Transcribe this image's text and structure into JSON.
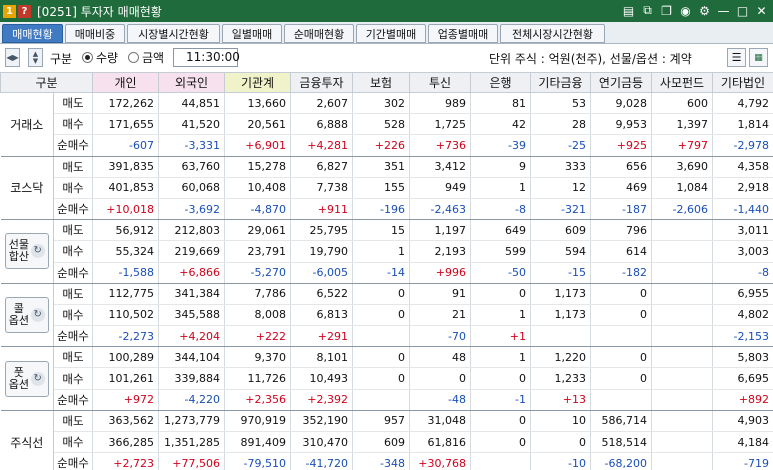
{
  "window": {
    "badge1": "1",
    "badge2": "?",
    "title": "[0251] 투자자 매매현황"
  },
  "tabs": [
    {
      "label": "매매현황",
      "active": true
    },
    {
      "label": "매매비중",
      "active": false
    },
    {
      "label": "시장별시간현황",
      "active": false
    },
    {
      "label": "일별매매",
      "active": false
    },
    {
      "label": "순매매현황",
      "active": false
    },
    {
      "label": "기간별매매",
      "active": false
    },
    {
      "label": "업종별매매",
      "active": false
    },
    {
      "label": "전체시장시간현황",
      "active": false
    }
  ],
  "toolbar": {
    "label": "구분",
    "radio_qty": "수량",
    "radio_amt": "금액",
    "selected": "수량",
    "time": "11:30:00",
    "unit_text": "단위 주식 : 억원(천주), 선물/옵션 : 계약"
  },
  "header": [
    "구분",
    "개인",
    "외국인",
    "기관계",
    "금융투자",
    "보험",
    "투신",
    "은행",
    "기타금융",
    "연기금등",
    "사모펀드",
    "기타법인"
  ],
  "groups": [
    {
      "name": "거래소",
      "button": false,
      "rows": [
        {
          "label": "매도",
          "values": [
            "172,262",
            "44,851",
            "13,660",
            "2,607",
            "302",
            "989",
            "81",
            "53",
            "9,028",
            "600",
            "4,792"
          ]
        },
        {
          "label": "매수",
          "values": [
            "171,655",
            "41,520",
            "20,561",
            "6,888",
            "528",
            "1,725",
            "42",
            "28",
            "9,953",
            "1,397",
            "1,814"
          ]
        },
        {
          "label": "순매수",
          "values": [
            "-607",
            "-3,331",
            "+6,901",
            "+4,281",
            "+226",
            "+736",
            "-39",
            "-25",
            "+925",
            "+797",
            "-2,978"
          ]
        }
      ]
    },
    {
      "name": "코스닥",
      "button": false,
      "rows": [
        {
          "label": "매도",
          "values": [
            "391,835",
            "63,760",
            "15,278",
            "6,827",
            "351",
            "3,412",
            "9",
            "333",
            "656",
            "3,690",
            "4,358"
          ]
        },
        {
          "label": "매수",
          "values": [
            "401,853",
            "60,068",
            "10,408",
            "7,738",
            "155",
            "949",
            "1",
            "12",
            "469",
            "1,084",
            "2,918"
          ]
        },
        {
          "label": "순매수",
          "values": [
            "+10,018",
            "-3,692",
            "-4,870",
            "+911",
            "-196",
            "-2,463",
            "-8",
            "-321",
            "-187",
            "-2,606",
            "-1,440"
          ]
        }
      ]
    },
    {
      "name": "선물\n합산",
      "button": true,
      "rows": [
        {
          "label": "매도",
          "values": [
            "56,912",
            "212,803",
            "29,061",
            "25,795",
            "15",
            "1,197",
            "649",
            "609",
            "796",
            "",
            "3,011"
          ]
        },
        {
          "label": "매수",
          "values": [
            "55,324",
            "219,669",
            "23,791",
            "19,790",
            "1",
            "2,193",
            "599",
            "594",
            "614",
            "",
            "3,003"
          ]
        },
        {
          "label": "순매수",
          "values": [
            "-1,588",
            "+6,866",
            "-5,270",
            "-6,005",
            "-14",
            "+996",
            "-50",
            "-15",
            "-182",
            "",
            "-8"
          ]
        }
      ]
    },
    {
      "name": "콜\n옵션",
      "button": true,
      "rows": [
        {
          "label": "매도",
          "values": [
            "112,775",
            "341,384",
            "7,786",
            "6,522",
            "0",
            "91",
            "0",
            "1,173",
            "0",
            "",
            "6,955"
          ]
        },
        {
          "label": "매수",
          "values": [
            "110,502",
            "345,588",
            "8,008",
            "6,813",
            "0",
            "21",
            "1",
            "1,173",
            "0",
            "",
            "4,802"
          ]
        },
        {
          "label": "순매수",
          "values": [
            "-2,273",
            "+4,204",
            "+222",
            "+291",
            "",
            "-70",
            "+1",
            "",
            "",
            "",
            "-2,153"
          ]
        }
      ]
    },
    {
      "name": "풋\n옵션",
      "button": true,
      "rows": [
        {
          "label": "매도",
          "values": [
            "100,289",
            "344,104",
            "9,370",
            "8,101",
            "0",
            "48",
            "1",
            "1,220",
            "0",
            "",
            "5,803"
          ]
        },
        {
          "label": "매수",
          "values": [
            "101,261",
            "339,884",
            "11,726",
            "10,493",
            "0",
            "0",
            "0",
            "1,233",
            "0",
            "",
            "6,695"
          ]
        },
        {
          "label": "순매수",
          "values": [
            "+972",
            "-4,220",
            "+2,356",
            "+2,392",
            "",
            "-48",
            "-1",
            "+13",
            "",
            "",
            "+892"
          ]
        }
      ]
    },
    {
      "name": "주식선",
      "button": false,
      "rows": [
        {
          "label": "매도",
          "values": [
            "363,562",
            "1,273,779",
            "970,919",
            "352,190",
            "957",
            "31,048",
            "0",
            "10",
            "586,714",
            "",
            "4,903"
          ]
        },
        {
          "label": "매수",
          "values": [
            "366,285",
            "1,351,285",
            "891,409",
            "310,470",
            "609",
            "61,816",
            "0",
            "0",
            "518,514",
            "",
            "4,184"
          ]
        },
        {
          "label": "순매수",
          "values": [
            "+2,723",
            "+77,506",
            "-79,510",
            "-41,720",
            "-348",
            "+30,768",
            "",
            "-10",
            "-68,200",
            "",
            "-719"
          ]
        }
      ]
    }
  ]
}
